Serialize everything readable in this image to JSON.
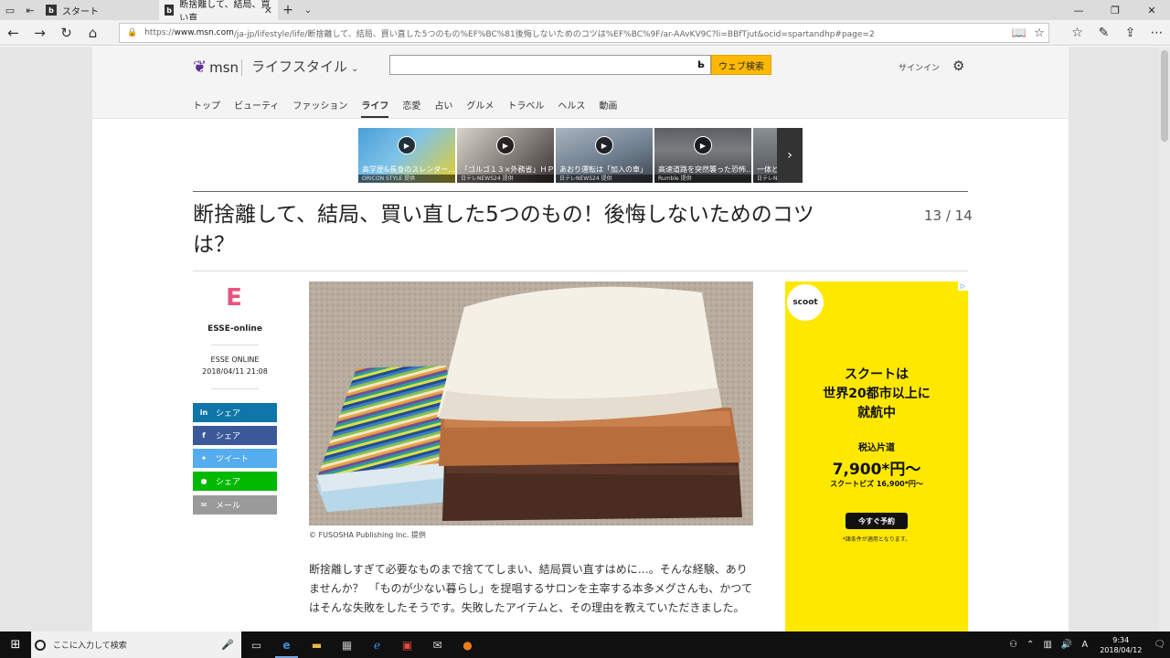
{
  "browser": {
    "tabs": [
      {
        "label": "スタート",
        "active": false
      },
      {
        "label": "断捨離して、結局、買い直",
        "active": true
      }
    ],
    "url_prefix": "https://",
    "url_host": "www.msn.com",
    "url_path": "/ja-jp/lifestyle/life/断捨離して、結局、買い直した5つのもの%EF%BC%81後悔しないためのコツは%EF%BC%9F/ar-AAvKV9C?li=BBfTjut&ocid=spartandhp#page=2"
  },
  "header": {
    "logo_text": "msn",
    "section": "ライフスタイル",
    "search_button": "ウェブ検索",
    "signin": "サインイン",
    "nav": [
      "トップ",
      "ビューティ",
      "ファッション",
      "ライフ",
      "恋愛",
      "占い",
      "グルメ",
      "トラベル",
      "ヘルス",
      "動画"
    ],
    "nav_active": "ライフ"
  },
  "carousel": [
    {
      "caption": "高学歴&長身のスレンダー…",
      "source": "ORICON STYLE 提供"
    },
    {
      "caption": "「ゴルゴ１３×外務省」ＨＰ…",
      "source": "日テレNEWS24 提供"
    },
    {
      "caption": "あおり運転は「加入の車」",
      "source": "日テレNEWS24 提供"
    },
    {
      "caption": "高速道路を突然襲った恐怖…",
      "source": "Rumble 提供"
    },
    {
      "caption": "一体どこ",
      "source": "日テレNEWS"
    }
  ],
  "article": {
    "title": "断捨離して、結局、買い直した5つのもの！後悔しないためのコツは？",
    "page_indicator": "13 / 14",
    "publisher_logo": "E",
    "publisher": "ESSE-online",
    "author": "ESSE ONLINE",
    "date": "2018/04/11 21:08",
    "photo_caption": "© FUSOSHA Publishing Inc. 提供",
    "body": "断捨離しすぎて必要なものまで捨ててしまい、結局買い直すはめに…。そんな経験、ありませんか？　「ものが少ない暮らし」を提唱するサロンを主宰する本多メグさんも、かつてはそんな失敗をしたそうです。失敗したアイテムと、その理由を教えていただきました。"
  },
  "share": [
    {
      "label": "シェア",
      "icon": "linkedin-icon",
      "color": "#0e76a8"
    },
    {
      "label": "シェア",
      "icon": "facebook-icon",
      "color": "#3b5998"
    },
    {
      "label": "ツイート",
      "icon": "twitter-icon",
      "color": "#55acee"
    },
    {
      "label": "シェア",
      "icon": "line-icon",
      "color": "#00b900"
    },
    {
      "label": "メール",
      "icon": "mail-icon",
      "color": "#9a9a9a"
    }
  ],
  "ad": {
    "brand": "scoot",
    "headline_1": "スクートは",
    "headline_2": "世界20都市以上に",
    "headline_3": "就航中",
    "fare_label": "税込片道",
    "price": "7,900*円～",
    "biz": "スクートビズ 16,900*円～",
    "cta": "今すぐ予約",
    "note": "*諸条件が適用となります。"
  },
  "taskbar": {
    "search_placeholder": "ここに入力して検索",
    "ime": "A",
    "time": "9:34",
    "date": "2018/04/12"
  }
}
